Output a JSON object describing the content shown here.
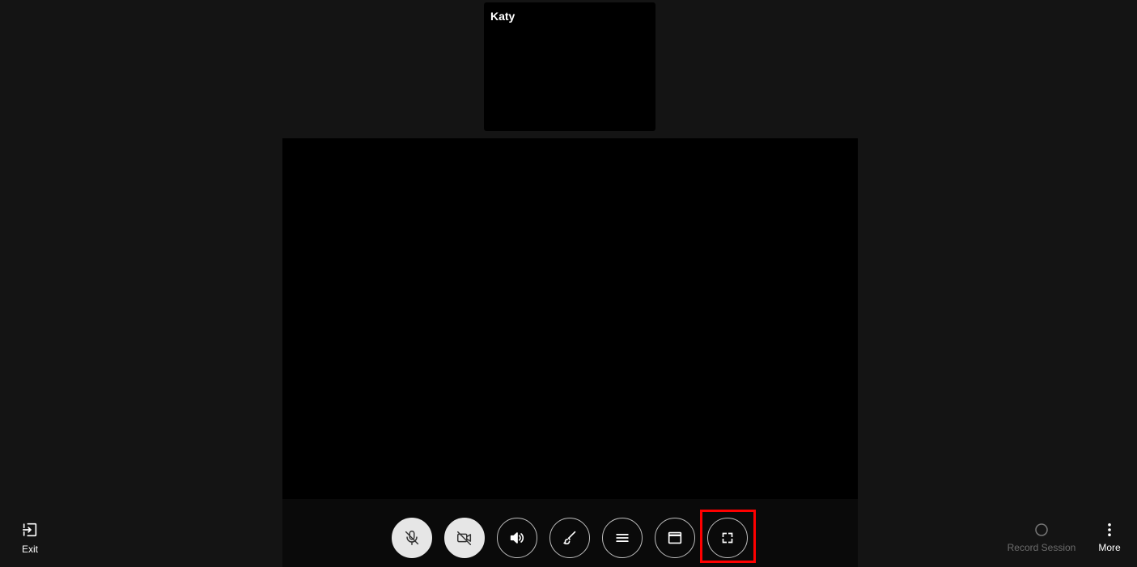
{
  "participant": {
    "name": "Katy"
  },
  "controls": {
    "exit_label": "Exit",
    "record_label": "Record Session",
    "more_label": "More"
  },
  "icons": {
    "mic": "mic-off-icon",
    "camera": "video-off-icon",
    "speaker": "volume-icon",
    "draw": "brush-icon",
    "menu": "menu-icon",
    "window": "window-icon",
    "fullscreen": "fullscreen-icon",
    "exit": "exit-icon",
    "record": "record-icon",
    "more": "more-vertical-icon"
  },
  "colors": {
    "background": "#141414",
    "video": "#000000",
    "highlight": "#ff0000",
    "button_filled": "#e6e6e6",
    "record_label": "#6c6c6c"
  }
}
